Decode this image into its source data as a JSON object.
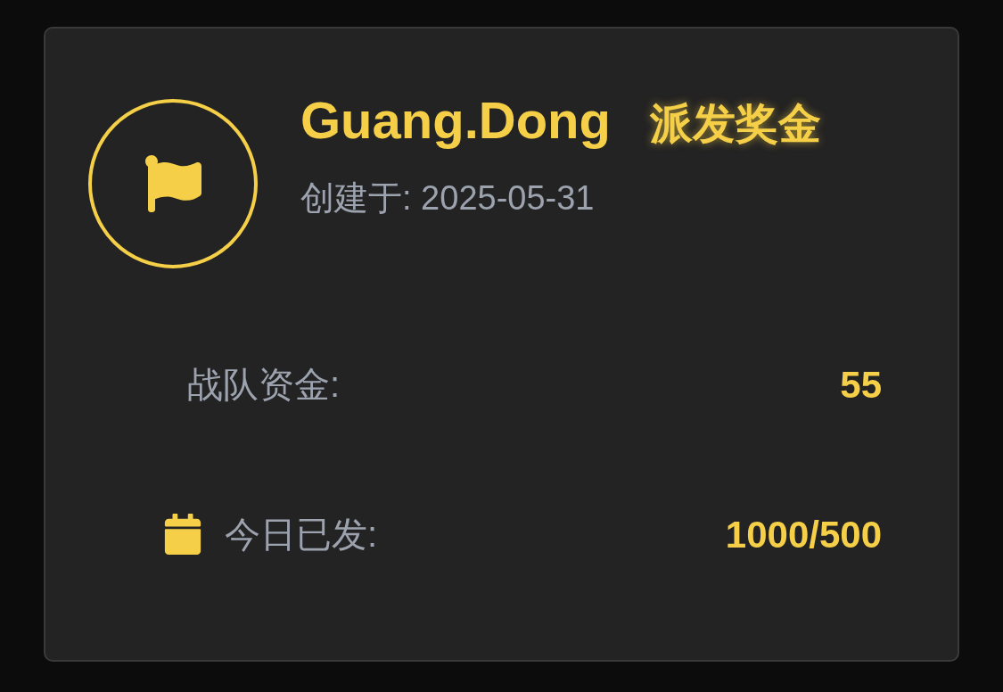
{
  "team": {
    "name": "Guang.Dong",
    "tag": "派发奖金",
    "created": "创建于: 2025-05-31"
  },
  "stats": [
    {
      "kind": "plain",
      "label": "战队资金:",
      "value": "55"
    },
    {
      "kind": "calendar",
      "label": "今日已发:",
      "value": "1000/500"
    }
  ]
}
